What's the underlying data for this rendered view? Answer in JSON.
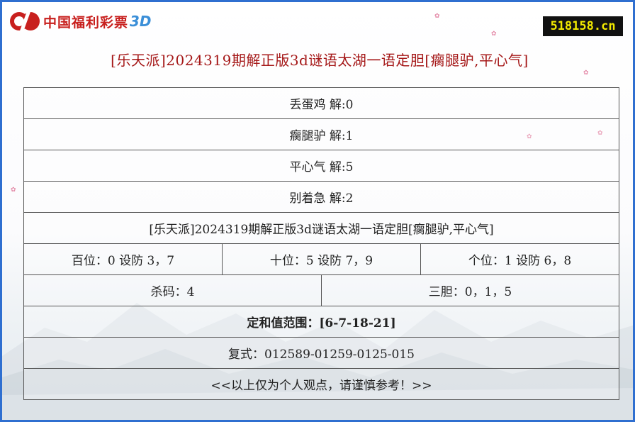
{
  "header": {
    "logo_text": "中国福利彩票",
    "logo_suffix": "3D",
    "site": "518158.cn",
    "title": "[乐天派]2024319期解正版3d谜语太湖一语定胆[瘸腿驴,平心气]"
  },
  "rows": [
    {
      "text": "丢蛋鸡 解:0"
    },
    {
      "text": "瘸腿驴 解:1"
    },
    {
      "text": "平心气 解:5"
    },
    {
      "text": "别着急 解:2"
    },
    {
      "text": "[乐天派]2024319期解正版3d谜语太湖一语定胆[瘸腿驴,平心气]"
    }
  ],
  "positions": {
    "hundreds": "百位：0 设防 3，7",
    "tens": "十位：5 设防 7，9",
    "units": "个位：1 设防 6，8"
  },
  "kill": "杀码：4",
  "three_dan": "三胆：0，1，5",
  "sum_range": "定和值范围：[6-7-18-21]",
  "compound": "复式：012589-01259-0125-015",
  "disclaimer": "<<以上仅为个人观点，请谨慎参考！>>",
  "colors": {
    "border": "#2f6fd0",
    "title": "#a51818",
    "logo_red": "#c8201e",
    "logo_blue": "#3b8fd8",
    "badge_bg": "#111111",
    "badge_fg": "#f2e900"
  }
}
